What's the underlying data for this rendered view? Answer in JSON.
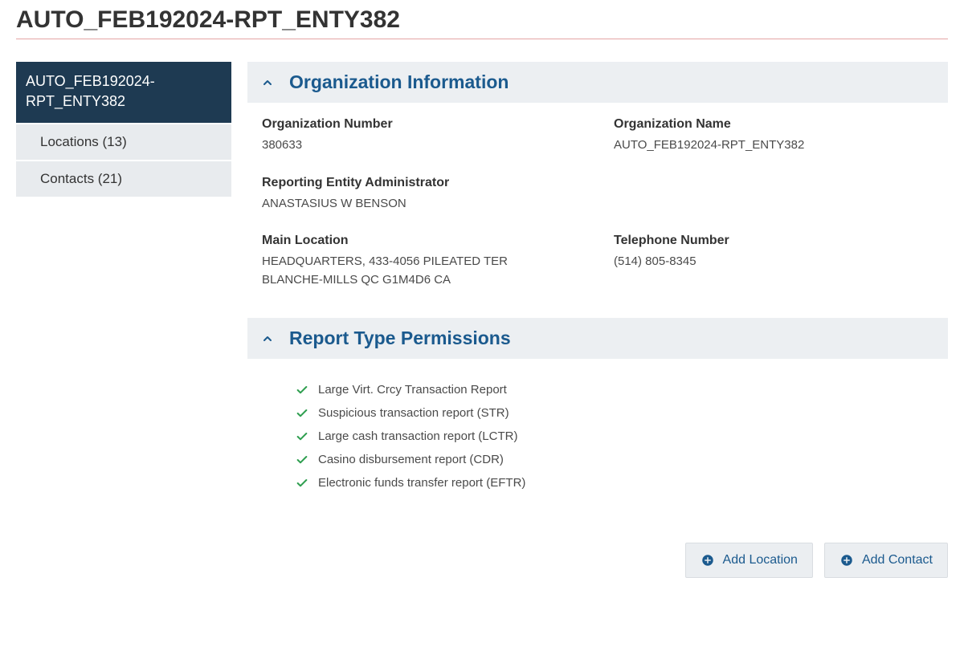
{
  "page_title": "AUTO_FEB192024-RPT_ENTY382",
  "sidebar": {
    "items": [
      {
        "label": "AUTO_FEB192024-RPT_ENTY382",
        "active": true
      },
      {
        "label": "Locations (13)"
      },
      {
        "label": "Contacts (21)"
      }
    ]
  },
  "sections": {
    "org_info": {
      "title": "Organization Information",
      "fields": {
        "org_number": {
          "label": "Organization Number",
          "value": "380633"
        },
        "org_name": {
          "label": "Organization Name",
          "value": "AUTO_FEB192024-RPT_ENTY382"
        },
        "admin": {
          "label": "Reporting Entity Administrator",
          "value": "ANASTASIUS W BENSON"
        },
        "main_location": {
          "label": "Main Location",
          "value": "HEADQUARTERS, 433-4056 PILEATED TER BLANCHE-MILLS QC G1M4D6 CA"
        },
        "telephone": {
          "label": "Telephone Number",
          "value": "(514) 805-8345"
        }
      }
    },
    "permissions": {
      "title": "Report Type Permissions",
      "items": [
        "Large Virt. Crcy Transaction Report",
        "Suspicious transaction report (STR)",
        "Large cash transaction report (LCTR)",
        "Casino disbursement report (CDR)",
        "Electronic funds transfer report (EFTR)"
      ]
    }
  },
  "actions": {
    "add_location": "Add Location",
    "add_contact": "Add Contact"
  },
  "colors": {
    "accent": "#1b5a8e",
    "check": "#2e9e4f"
  }
}
